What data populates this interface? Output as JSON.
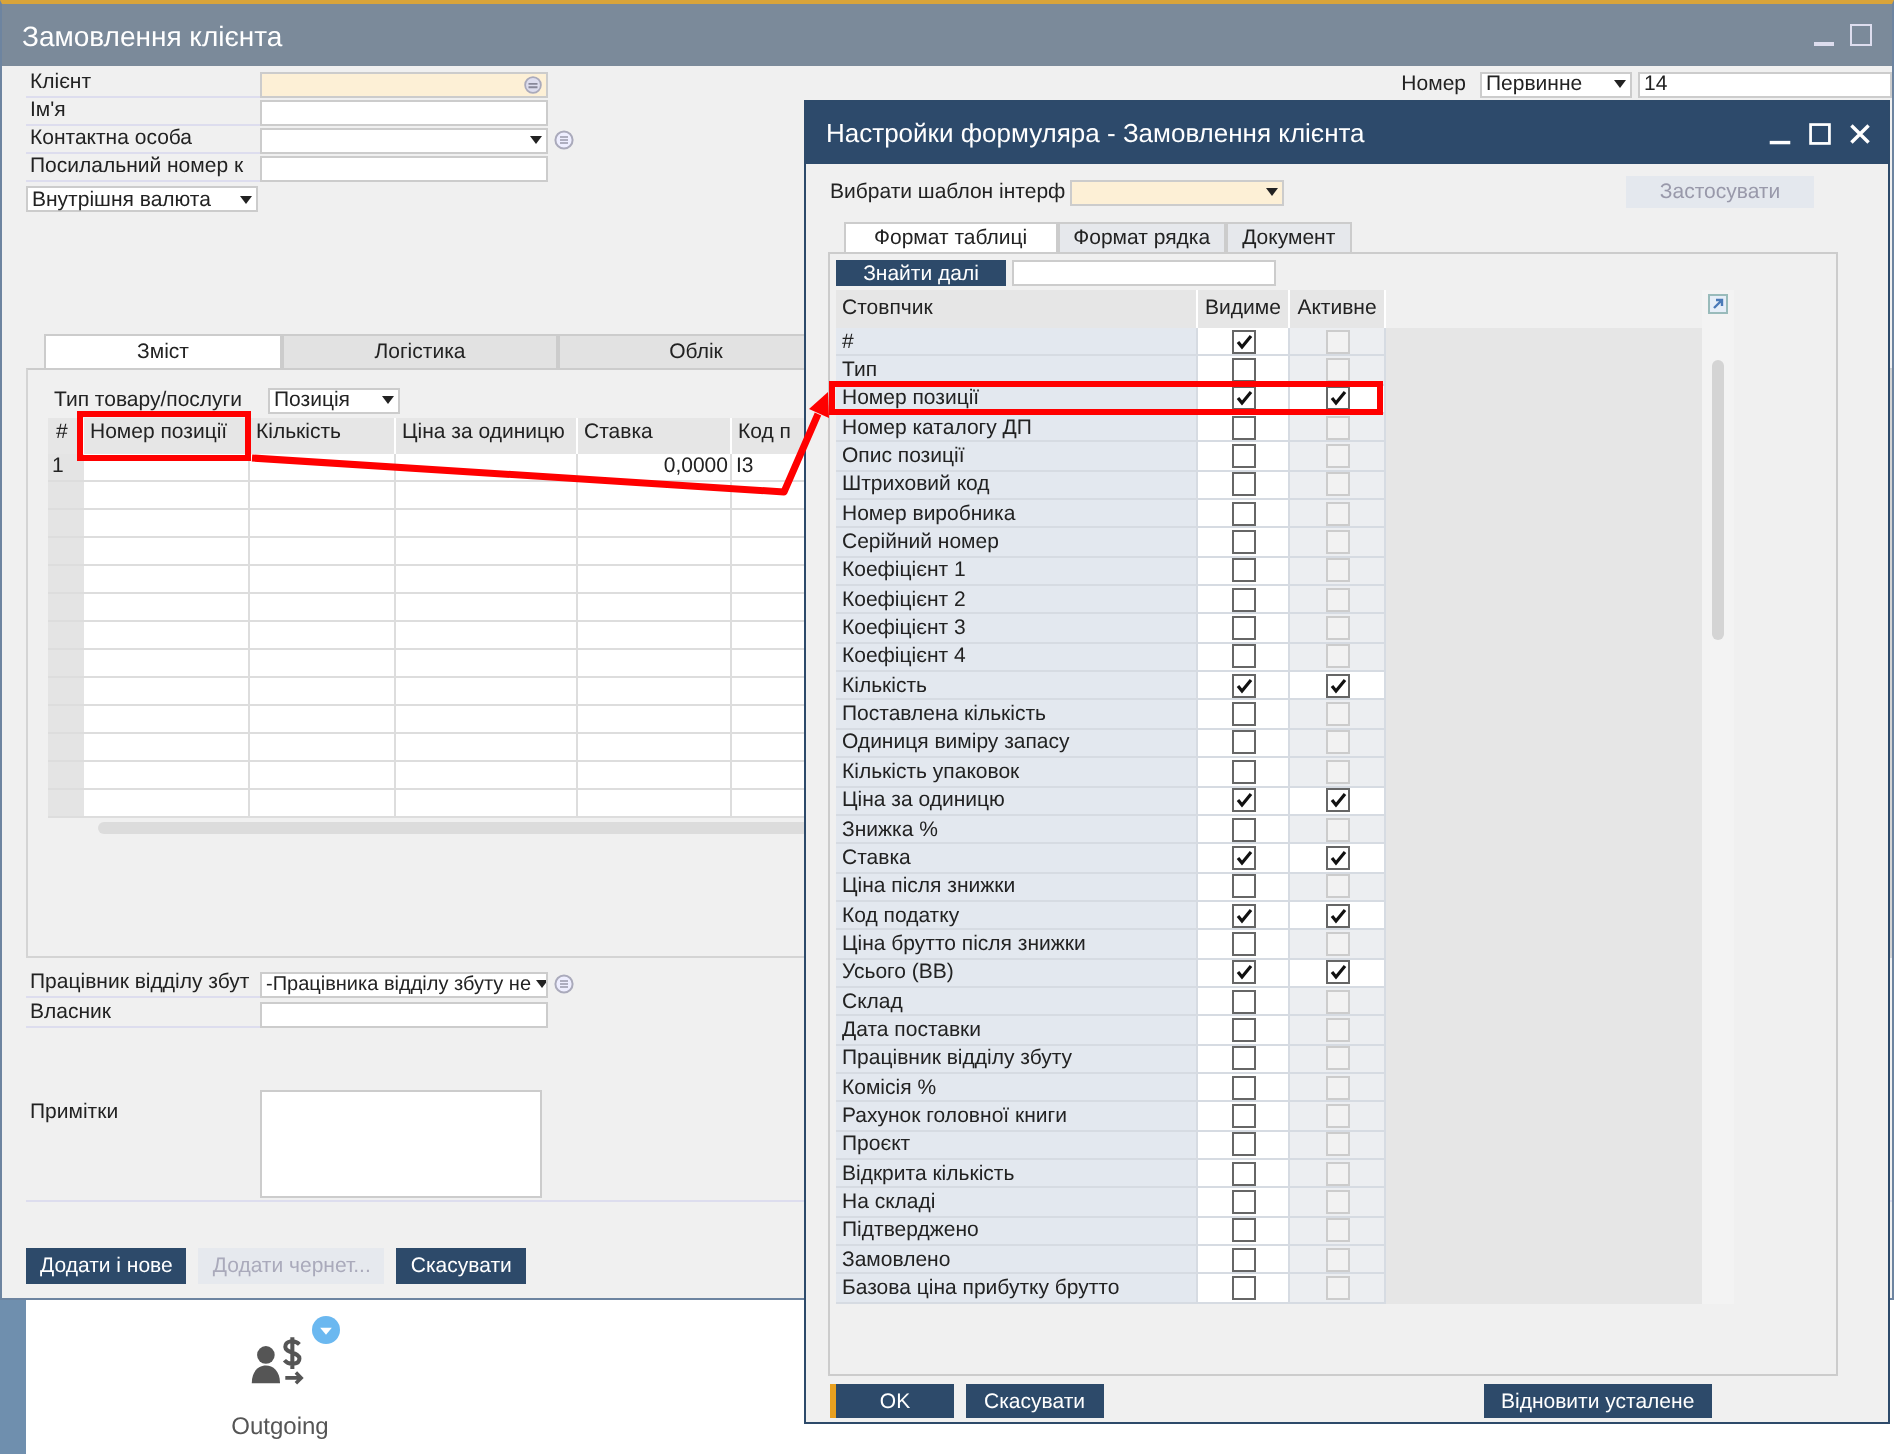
{
  "main_window": {
    "title": "Замовлення клієнта",
    "header_fields": [
      {
        "label": "Клієнт",
        "kind": "lookup"
      },
      {
        "label": "Ім'я",
        "kind": "text"
      },
      {
        "label": "Контактна особа",
        "kind": "dropdown"
      },
      {
        "label": "Посилальний номер к",
        "kind": "text"
      }
    ],
    "currency": "Внутрішня валюта",
    "number": {
      "label": "Номер",
      "series": "Первинне",
      "value": "14"
    },
    "tabs": [
      {
        "label": "Зміст",
        "selected": true
      },
      {
        "label": "Логістика",
        "selected": false
      },
      {
        "label": "Облік",
        "selected": false
      }
    ],
    "item_type": {
      "label": "Тип товару/послуги",
      "value": "Позиція"
    },
    "table": {
      "columns": [
        "#",
        "Номер позиції",
        "Кількість",
        "Ціна за одиницю",
        "Ставка",
        "Код п"
      ],
      "rows": [
        {
          "number": "1",
          "rate": "0,0000",
          "tax_code": "I3"
        }
      ]
    },
    "sales_employee": {
      "label": "Працівник відділу збут",
      "value": "-Працівника відділу збуту не"
    },
    "owner": {
      "label": "Власник"
    },
    "remarks": {
      "label": "Примітки"
    },
    "buttons": [
      {
        "label": "Додати і нове",
        "disabled": false
      },
      {
        "label": "Додати чернет...",
        "disabled": true
      },
      {
        "label": "Скасувати",
        "disabled": false
      }
    ]
  },
  "desktop": {
    "tile": {
      "label": "Outgoing"
    }
  },
  "dialog": {
    "title": "Настройки формуляра - Замовлення клієнта",
    "template_label": "Вибрати шаблон інтерф",
    "apply_button": {
      "label": "Застосувати",
      "disabled": true
    },
    "tabs": [
      {
        "label": "Формат таблиці",
        "selected": true
      },
      {
        "label": "Формат рядка",
        "selected": false
      },
      {
        "label": "Документ",
        "selected": false
      }
    ],
    "find_button": "Знайти далі",
    "columns": [
      "Стовпчик",
      "Видиме",
      "Активне"
    ],
    "rows": [
      {
        "name": "#",
        "visible": true,
        "active": false,
        "active_disabled": true
      },
      {
        "name": "Тип",
        "visible": false,
        "active": false,
        "active_disabled": true
      },
      {
        "name": "Номер позиції",
        "visible": true,
        "active": true,
        "active_disabled": false
      },
      {
        "name": "Номер каталогу ДП",
        "visible": false,
        "active": false,
        "active_disabled": true
      },
      {
        "name": "Опис позиції",
        "visible": false,
        "active": false,
        "active_disabled": true
      },
      {
        "name": "Штриховий код",
        "visible": false,
        "active": false,
        "active_disabled": true
      },
      {
        "name": "Номер виробника",
        "visible": false,
        "active": false,
        "active_disabled": true
      },
      {
        "name": "Серійний номер",
        "visible": false,
        "active": false,
        "active_disabled": true
      },
      {
        "name": "Коефіцієнт 1",
        "visible": false,
        "active": false,
        "active_disabled": true
      },
      {
        "name": "Коефіцієнт 2",
        "visible": false,
        "active": false,
        "active_disabled": true
      },
      {
        "name": "Коефіцієнт 3",
        "visible": false,
        "active": false,
        "active_disabled": true
      },
      {
        "name": "Коефіцієнт 4",
        "visible": false,
        "active": false,
        "active_disabled": true
      },
      {
        "name": "Кількість",
        "visible": true,
        "active": true,
        "active_disabled": false
      },
      {
        "name": "Поставлена кількість",
        "visible": false,
        "active": false,
        "active_disabled": true
      },
      {
        "name": "Одиниця виміру запасу",
        "visible": false,
        "active": false,
        "active_disabled": true
      },
      {
        "name": "Кількість упаковок",
        "visible": false,
        "active": false,
        "active_disabled": true
      },
      {
        "name": "Ціна за одиницю",
        "visible": true,
        "active": true,
        "active_disabled": false
      },
      {
        "name": "Знижка %",
        "visible": false,
        "active": false,
        "active_disabled": true
      },
      {
        "name": "Ставка",
        "visible": true,
        "active": true,
        "active_disabled": false
      },
      {
        "name": "Ціна після знижки",
        "visible": false,
        "active": false,
        "active_disabled": true
      },
      {
        "name": "Код податку",
        "visible": true,
        "active": true,
        "active_disabled": false
      },
      {
        "name": "Ціна брутто після знижки",
        "visible": false,
        "active": false,
        "active_disabled": true
      },
      {
        "name": "Усього (ВВ)",
        "visible": true,
        "active": true,
        "active_disabled": false
      },
      {
        "name": "Склад",
        "visible": false,
        "active": false,
        "active_disabled": true
      },
      {
        "name": "Дата поставки",
        "visible": false,
        "active": false,
        "active_disabled": true
      },
      {
        "name": "Працівник відділу збуту",
        "visible": false,
        "active": false,
        "active_disabled": true
      },
      {
        "name": "Комісія %",
        "visible": false,
        "active": false,
        "active_disabled": true
      },
      {
        "name": "Рахунок головної книги",
        "visible": false,
        "active": false,
        "active_disabled": true
      },
      {
        "name": "Проєкт",
        "visible": false,
        "active": false,
        "active_disabled": true
      },
      {
        "name": "Відкрита кількість",
        "visible": false,
        "active": false,
        "active_disabled": true
      },
      {
        "name": "На складі",
        "visible": false,
        "active": false,
        "active_disabled": true
      },
      {
        "name": "Підтверджено",
        "visible": false,
        "active": false,
        "active_disabled": true
      },
      {
        "name": "Замовлено",
        "visible": false,
        "active": false,
        "active_disabled": true
      },
      {
        "name": "Базова ціна прибутку брутто",
        "visible": false,
        "active": false,
        "active_disabled": true
      }
    ],
    "buttons": [
      {
        "label": "OK",
        "kind": "default"
      },
      {
        "label": "Скасувати",
        "kind": "normal"
      },
      {
        "label": "Відновити усталене",
        "kind": "reset"
      }
    ]
  }
}
